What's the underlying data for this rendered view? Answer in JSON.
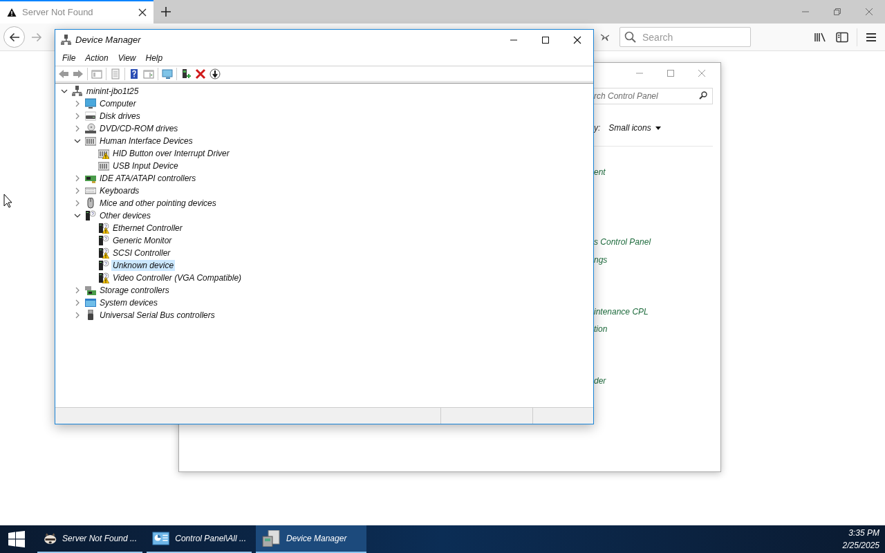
{
  "browser": {
    "tab": {
      "title": "Server Not Found",
      "selected": true
    },
    "search": {
      "placeholder": "Search"
    }
  },
  "control_panel": {
    "search": {
      "placeholder": "rch Control Panel"
    },
    "view_by_label": "y:",
    "view_by_value": "Small icons",
    "links": [
      "ent",
      "s Control Panel",
      "ngs",
      "intenance CPL",
      "tion",
      "der"
    ]
  },
  "device_manager": {
    "window": {
      "title": "Device Manager"
    },
    "menu": [
      "File",
      "Action",
      "View",
      "Help"
    ],
    "tree": {
      "label": "minint-jbo1t25",
      "expanded": true,
      "selected": false,
      "children": [
        {
          "label": "Computer",
          "expanded": false,
          "selected": false
        },
        {
          "label": "Disk drives",
          "expanded": false,
          "selected": false
        },
        {
          "label": "DVD/CD-ROM drives",
          "expanded": false,
          "selected": false
        },
        {
          "label": "Human Interface Devices",
          "expanded": true,
          "selected": false,
          "children": [
            {
              "label": "HID Button over Interrupt Driver",
              "warning": true,
              "selected": false
            },
            {
              "label": "USB Input Device",
              "warning": false,
              "selected": false
            }
          ]
        },
        {
          "label": "IDE ATA/ATAPI controllers",
          "expanded": false,
          "selected": false
        },
        {
          "label": "Keyboards",
          "expanded": false,
          "selected": false
        },
        {
          "label": "Mice and other pointing devices",
          "expanded": false,
          "selected": false
        },
        {
          "label": "Other devices",
          "expanded": true,
          "selected": false,
          "children": [
            {
              "label": "Ethernet Controller",
              "warning": true,
              "selected": false
            },
            {
              "label": "Generic Monitor",
              "warning": false,
              "selected": false
            },
            {
              "label": "SCSI Controller",
              "warning": true,
              "selected": false
            },
            {
              "label": "Unknown device",
              "warning": false,
              "selected": true
            },
            {
              "label": "Video Controller (VGA Compatible)",
              "warning": true,
              "selected": false
            }
          ]
        },
        {
          "label": "Storage controllers",
          "expanded": false,
          "selected": false
        },
        {
          "label": "System devices",
          "expanded": false,
          "selected": false
        },
        {
          "label": "Universal Serial Bus controllers",
          "expanded": false,
          "selected": false
        }
      ]
    }
  },
  "taskbar": {
    "items": [
      {
        "label": "Server Not Found ...",
        "selected": false
      },
      {
        "label": "Control Panel\\All ...",
        "selected": false
      },
      {
        "label": "Device Manager",
        "selected": true
      }
    ],
    "clock": {
      "time": "3:35 PM",
      "date": "2/25/2025"
    }
  }
}
